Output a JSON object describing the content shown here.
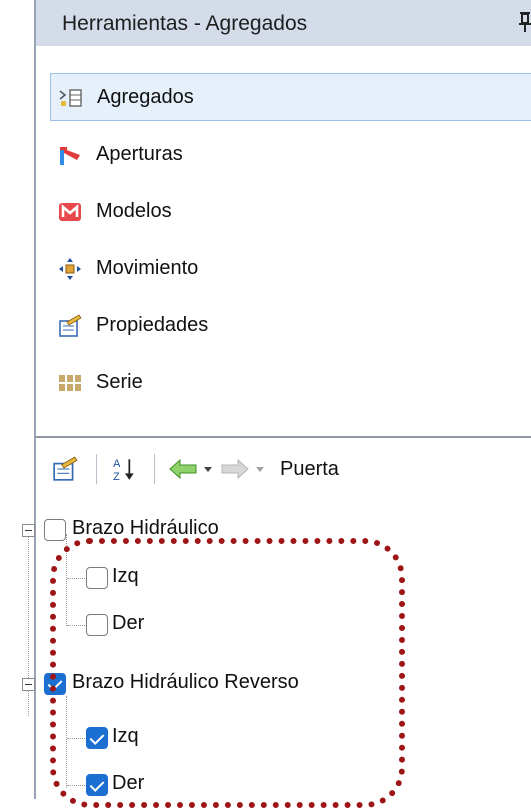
{
  "panel": {
    "title": "Herramientas - Agregados"
  },
  "toolbox": {
    "items": [
      {
        "label": "Agregados",
        "icon": "aggregates-icon",
        "selected": true
      },
      {
        "label": "Aperturas",
        "icon": "openings-icon"
      },
      {
        "label": "Modelos",
        "icon": "models-icon"
      },
      {
        "label": "Movimiento",
        "icon": "movement-icon"
      },
      {
        "label": "Propiedades",
        "icon": "properties-icon"
      },
      {
        "label": "Serie",
        "icon": "series-icon"
      }
    ]
  },
  "toolbar": {
    "current_label": "Puerta"
  },
  "tree": {
    "nodes": [
      {
        "label": "Brazo Hidráulico",
        "checked": false,
        "children": [
          {
            "label": "Izq",
            "checked": false
          },
          {
            "label": "Der",
            "checked": false
          }
        ]
      },
      {
        "label": "Brazo Hidráulico Reverso",
        "checked": true,
        "children": [
          {
            "label": "Izq",
            "checked": true
          },
          {
            "label": "Der",
            "checked": true
          }
        ]
      }
    ]
  },
  "colors": {
    "titlebar": "#d4dbe9",
    "selection": "#e5f0fb",
    "checkbox_checked": "#1a6fd1",
    "highlight": "#9e1515"
  }
}
